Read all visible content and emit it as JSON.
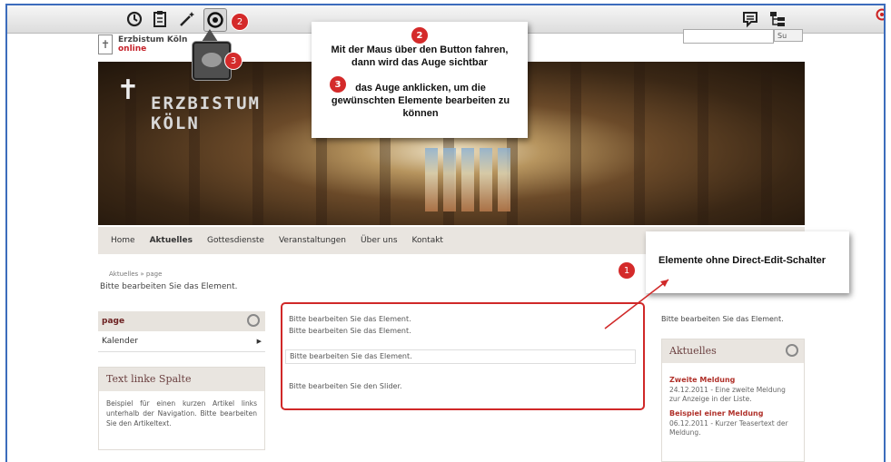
{
  "callouts": {
    "step2_badge": "2",
    "step2_text": "Mit der Maus über den Button fahren, dann wird das Auge sichtbar",
    "step3_badge": "3",
    "step3_text": "das Auge anklicken, um die gewünschten Elemente bearbeiten zu können",
    "step1_badge": "1",
    "step1_text": "Elemente ohne Direct-Edit-Schalter"
  },
  "toolbar": {
    "icons": [
      "history-icon",
      "clipboard-icon",
      "magic-wand-icon",
      "direct-edit-icon",
      "comment-icon",
      "sitemap-icon",
      "close-icon"
    ],
    "badge_2": "2",
    "badge_3": "3"
  },
  "logo": {
    "line1": "Erzbistum Köln",
    "line2": "online"
  },
  "search": {
    "button_label": "Su"
  },
  "banner": {
    "title_line1": "ERZBISTUM",
    "title_line2": "KÖLN"
  },
  "nav": {
    "items": [
      "Home",
      "Aktuelles",
      "Gottesdienste",
      "Veranstaltungen",
      "Über uns",
      "Kontakt"
    ],
    "active": "Aktuelles"
  },
  "content": {
    "breadcrumb": "Aktuelles » page",
    "intro": "Bitte bearbeiten Sie das Element.",
    "center_line1": "Bitte bearbeiten Sie das Element.",
    "center_line2": "Bitte bearbeiten Sie das Element.",
    "center_line3": "Bitte bearbeiten Sie das Element.",
    "center_line4": "Bitte bearbeiten Sie den Slider."
  },
  "left": {
    "page_label": "page",
    "calendar_label": "Kalender",
    "text_box_title": "Text linke Spalte",
    "text_box_body": "Beispiel für einen kurzen Artikel links unterhalb der Navigation. Bitte bearbeiten Sie den Artikeltext."
  },
  "right": {
    "edit_text": "Bitte bearbeiten Sie das Element.",
    "box_title": "Aktuelles",
    "news": [
      {
        "title": "Zweite Meldung",
        "body": "24.12.2011 - Eine zweite Meldung zur Anzeige in der Liste."
      },
      {
        "title": "Beispiel einer Meldung",
        "body": "06.12.2011 - Kurzer Teasertext der Meldung."
      }
    ]
  },
  "colors": {
    "frame": "#3c6cbc",
    "badge": "#d42a2a",
    "highlight_border": "#d02828",
    "news_title": "#b0312a"
  }
}
